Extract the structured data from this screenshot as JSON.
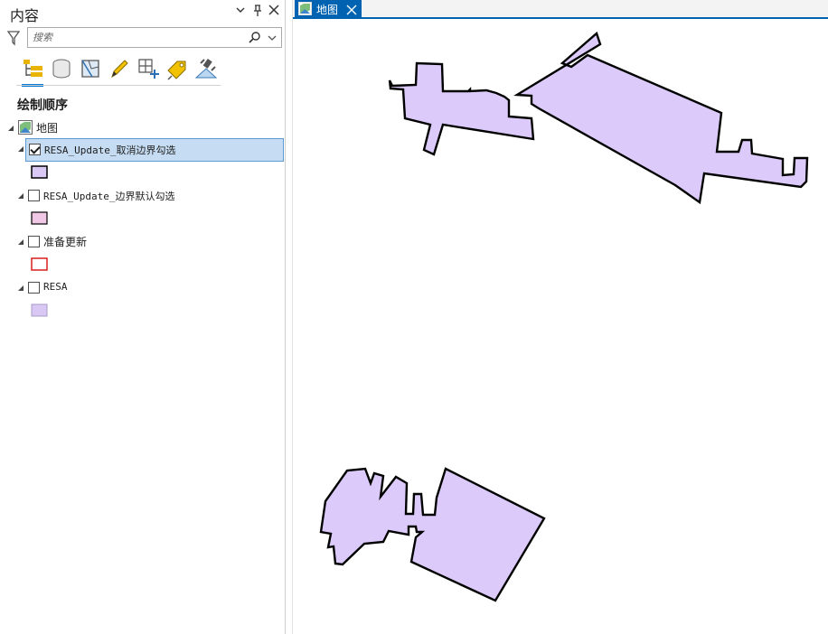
{
  "contents_pane": {
    "title": "内容",
    "search_placeholder": "搜索",
    "section_title": "绘制顺序",
    "map_node": {
      "label": "地图"
    },
    "layers": [
      {
        "label": "RESA_Update_取消边界勾选",
        "checked": true,
        "selected": true,
        "fill": "#d9c8f4",
        "stroke": "#000000"
      },
      {
        "label": "RESA_Update_边界默认勾选",
        "checked": false,
        "selected": false,
        "fill": "#f0c8e6",
        "stroke": "#000000"
      },
      {
        "label": "准备更新",
        "checked": false,
        "selected": false,
        "fill": "#ffffff",
        "stroke": "#d81e1e"
      },
      {
        "label": "RESA",
        "checked": false,
        "selected": false,
        "fill": "#d9c8f4",
        "stroke": "#a89bc7"
      }
    ]
  },
  "map_view": {
    "tab_label": "地图",
    "polygon_fill": "#dccbfa",
    "polygon_stroke": "#000000"
  },
  "colors": {
    "accent": "#0063b1",
    "selection": "#c5dcf2"
  }
}
